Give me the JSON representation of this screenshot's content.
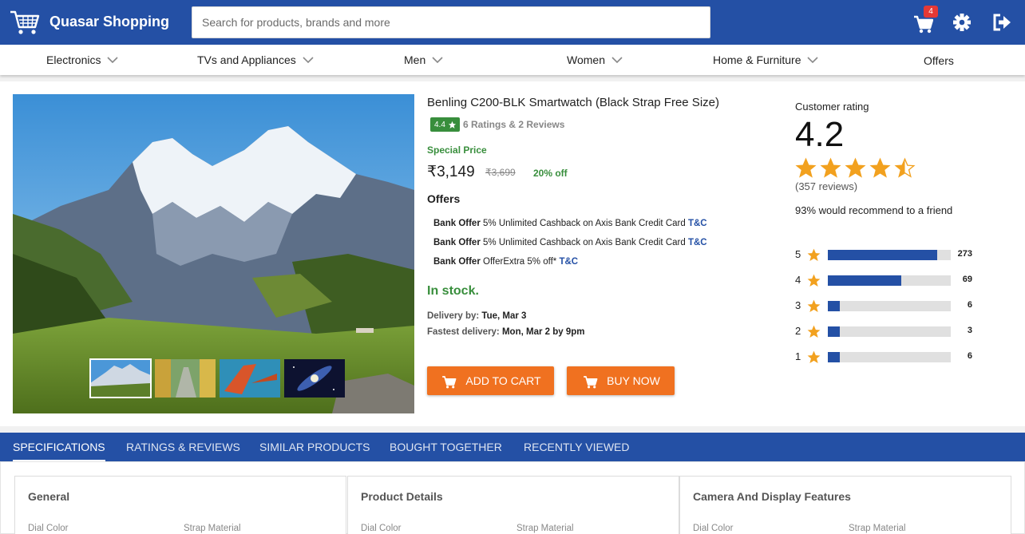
{
  "header": {
    "brand": "Quasar Shopping",
    "search_placeholder": "Search for products, brands and more",
    "cart_count": "4"
  },
  "nav": {
    "categories": [
      "Electronics",
      "TVs and Appliances",
      "Men",
      "Women",
      "Home & Furniture"
    ],
    "offers": "Offers"
  },
  "product": {
    "title": "Benling C200-BLK Smartwatch (Black Strap Free Size)",
    "rating": "4.4",
    "rating_summary": "6 Ratings & 2 Reviews",
    "special_price_label": "Special Price",
    "price": "₹3,149",
    "mrp": "₹3,699",
    "discount": "20% off",
    "offers_heading": "Offers",
    "offers": [
      {
        "type": "Bank Offer",
        "text": "5% Unlimited Cashback on Axis Bank Credit Card",
        "link": "T&C"
      },
      {
        "type": "Bank Offer",
        "text": "5% Unlimited Cashback on Axis Bank Credit Card",
        "link": "T&C"
      },
      {
        "type": "Bank Offer",
        "text": "OfferExtra 5% off*",
        "link": "T&C"
      }
    ],
    "stock": "In stock.",
    "delivery_label": "Delivery by:",
    "delivery_value": "Tue, Mar 3",
    "fastest_label": "Fastest delivery:",
    "fastest_value": "Mon, Mar 2 by 9pm",
    "add_to_cart": "ADD TO CART",
    "buy_now": "BUY NOW"
  },
  "ratings": {
    "label": "Customer rating",
    "score": "4.2",
    "stars": 4.5,
    "reviews": "(357 reviews)",
    "recommend": "93% would recommend to a friend",
    "bars": [
      {
        "star": "5",
        "count": "273",
        "fraction": 0.89
      },
      {
        "star": "4",
        "count": "69",
        "fraction": 0.6
      },
      {
        "star": "3",
        "count": "6",
        "fraction": 0.1
      },
      {
        "star": "2",
        "count": "3",
        "fraction": 0.1
      },
      {
        "star": "1",
        "count": "6",
        "fraction": 0.1
      }
    ]
  },
  "tabs": [
    "SPECIFICATIONS",
    "RATINGS & REVIEWS",
    "SIMILAR PRODUCTS",
    "BOUGHT TOGETHER",
    "RECENTLY VIEWED"
  ],
  "specs": [
    {
      "title": "General",
      "left": "Dial Color",
      "right": "Strap Material"
    },
    {
      "title": "Product Details",
      "left": "Dial Color",
      "right": "Strap Material"
    },
    {
      "title": "Camera And Display Features",
      "left": "Dial Color",
      "right": "Strap Material"
    }
  ],
  "colors": {
    "primary": "#2450a5",
    "accent": "#f07120",
    "green": "#388e3c",
    "star": "#f2a11f"
  }
}
